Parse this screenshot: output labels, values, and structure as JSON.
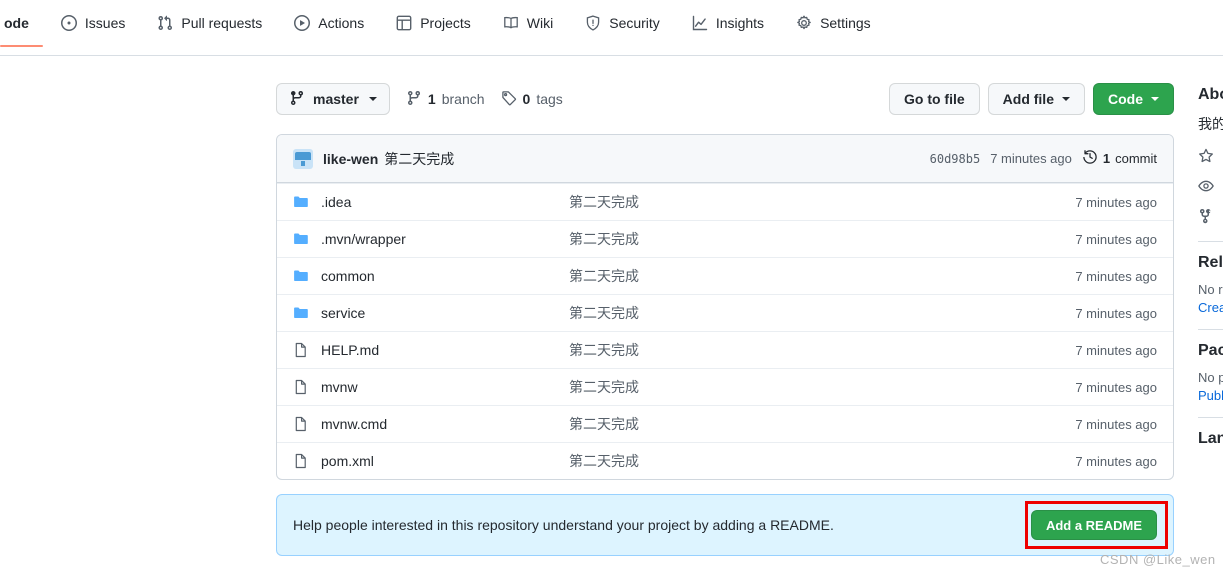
{
  "nav": {
    "items": [
      {
        "label": "ode",
        "icon": "code-icon",
        "selected": true,
        "clipped": true
      },
      {
        "label": "Issues",
        "icon": "issue-opened-icon",
        "selected": false
      },
      {
        "label": "Pull requests",
        "icon": "git-pull-request-icon",
        "selected": false
      },
      {
        "label": "Actions",
        "icon": "play-icon",
        "selected": false
      },
      {
        "label": "Projects",
        "icon": "table-icon",
        "selected": false
      },
      {
        "label": "Wiki",
        "icon": "book-icon",
        "selected": false
      },
      {
        "label": "Security",
        "icon": "shield-icon",
        "selected": false
      },
      {
        "label": "Insights",
        "icon": "graph-icon",
        "selected": false
      },
      {
        "label": "Settings",
        "icon": "gear-icon",
        "selected": false
      }
    ]
  },
  "toolbar": {
    "branch": "master",
    "branch_count": "1",
    "branch_label": "branch",
    "tag_count": "0",
    "tag_label": "tags",
    "go_to_file": "Go to file",
    "add_file": "Add file",
    "code": "Code"
  },
  "commit_bar": {
    "author": "like-wen",
    "message": "第二天完成",
    "sha": "60d98b5",
    "time": "7 minutes ago",
    "commit_count": "1",
    "commit_word": "commit"
  },
  "files": [
    {
      "name": ".idea",
      "type": "folder",
      "message": "第二天完成",
      "time": "7 minutes ago"
    },
    {
      "name": ".mvn/wrapper",
      "type": "folder",
      "message": "第二天完成",
      "time": "7 minutes ago"
    },
    {
      "name": "common",
      "type": "folder",
      "message": "第二天完成",
      "time": "7 minutes ago"
    },
    {
      "name": "service",
      "type": "folder",
      "message": "第二天完成",
      "time": "7 minutes ago"
    },
    {
      "name": "HELP.md",
      "type": "file",
      "message": "第二天完成",
      "time": "7 minutes ago"
    },
    {
      "name": "mvnw",
      "type": "file",
      "message": "第二天完成",
      "time": "7 minutes ago"
    },
    {
      "name": "mvnw.cmd",
      "type": "file",
      "message": "第二天完成",
      "time": "7 minutes ago"
    },
    {
      "name": "pom.xml",
      "type": "file",
      "message": "第二天完成",
      "time": "7 minutes ago"
    }
  ],
  "readme_callout": {
    "text": "Help people interested in this repository understand your project by adding a README.",
    "button": "Add a README"
  },
  "sidebar": {
    "about_heading": "Abo",
    "about_text": "我的",
    "releases_heading": "Rele",
    "releases_none": "No re",
    "releases_link": "Creat",
    "packages_heading": "Pack",
    "packages_none": "No p",
    "packages_link": "Publi",
    "languages_heading": "Lan"
  },
  "watermark": "CSDN @Like_wen",
  "colors": {
    "accent_green": "#2da44e",
    "link_blue": "#0969da",
    "callout_bg": "#ddf4ff",
    "tab_underline": "#fd8c73",
    "folder_blue": "#54aeff",
    "annotation_red": "#ee0000"
  }
}
